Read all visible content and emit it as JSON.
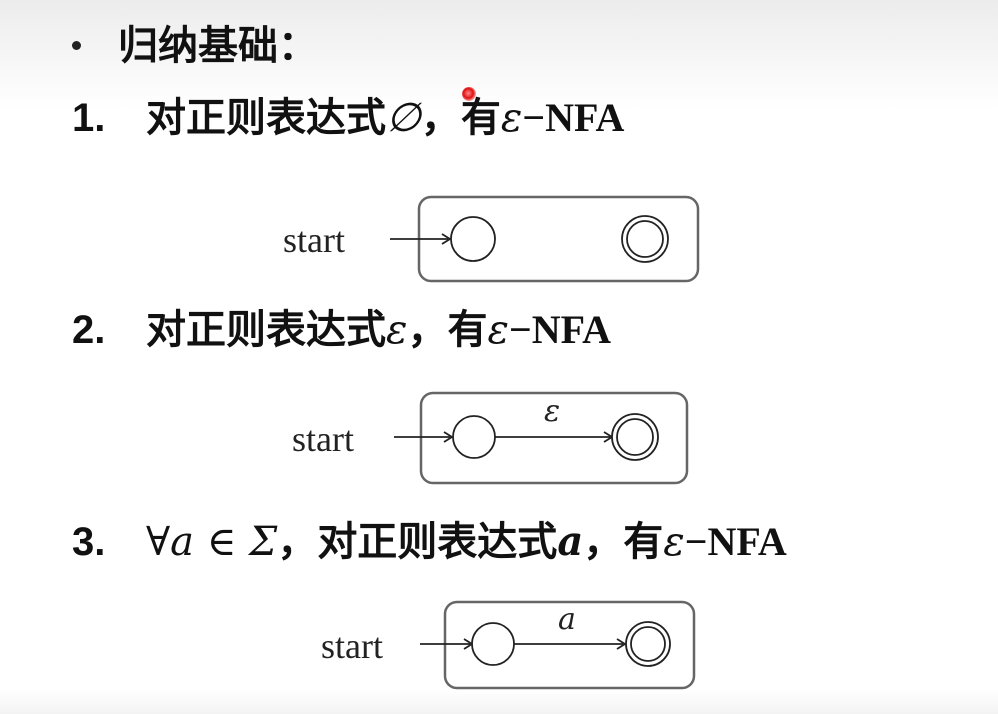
{
  "heading": "归纳基础：",
  "items": [
    {
      "number": "1.",
      "prefix": "对正则表达式",
      "symbol": "∅",
      "middle": "，有",
      "eps": "ε",
      "dash": "−",
      "nfa": "NFA",
      "diagram": {
        "start_label": "start",
        "edge_label": ""
      }
    },
    {
      "number": "2.",
      "prefix": "对正则表达式",
      "symbol": "ε",
      "middle": "，有",
      "eps": "ε",
      "dash": "−",
      "nfa": "NFA",
      "diagram": {
        "start_label": "start",
        "edge_label": "ε"
      }
    },
    {
      "number": "3.",
      "quantifier": "∀a ∈ Σ",
      "comma": "，",
      "prefix": "对正则表达式",
      "symbol": "a",
      "middle": "，有",
      "eps": "ε",
      "dash": "−",
      "nfa": "NFA",
      "diagram": {
        "start_label": "start",
        "edge_label": "a"
      }
    }
  ]
}
